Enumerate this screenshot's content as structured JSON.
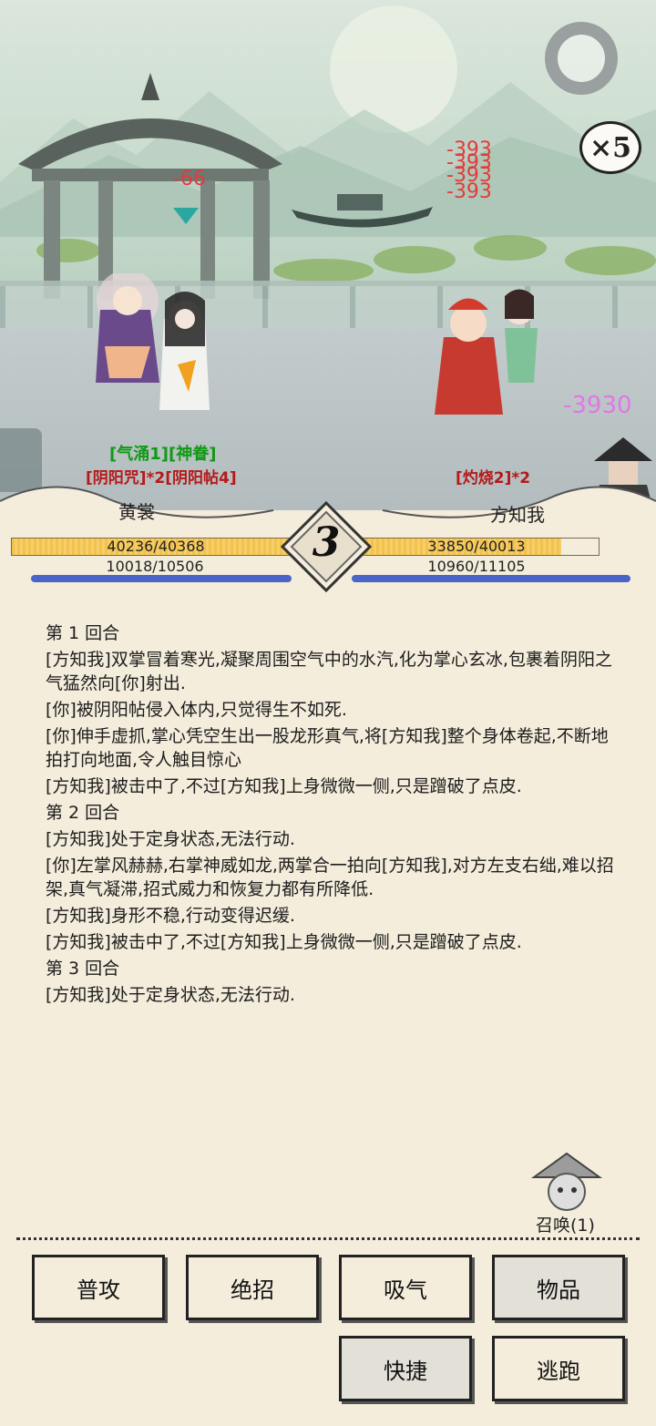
{
  "battle": {
    "speed": "×5",
    "damage_left": "-66",
    "damage_stack": [
      "-393",
      "-393",
      "-393",
      "-393"
    ],
    "damage_big": "-3930",
    "player_status_green": "[气涌1][神眷]",
    "player_status_red": "[阴阳咒]*2[阴阳帖4]",
    "enemy_status_red": "[灼烧2]*2"
  },
  "player": {
    "name": "黄裳",
    "hp": "40236/40368",
    "hp_fraction": 0.997,
    "mp": "10018/10506",
    "mp_fraction": 0.954
  },
  "enemy": {
    "name": "方知我",
    "hp": "33850/40013",
    "hp_fraction": 0.846,
    "mp": "10960/11105",
    "mp_fraction": 0.987
  },
  "round_number": "3",
  "log": [
    {
      "text": "第 1 回合",
      "round": true
    },
    {
      "text": "[方知我]双掌冒着寒光,凝聚周围空气中的水汽,化为掌心玄冰,包裹着阴阳之气猛然向[你]射出."
    },
    {
      "text": "[你]被阴阳帖侵入体内,只觉得生不如死."
    },
    {
      "text": "[你]伸手虚抓,掌心凭空生出一股龙形真气,将[方知我]整个身体卷起,不断地拍打向地面,令人触目惊心"
    },
    {
      "text": "[方知我]被击中了,不过[方知我]上身微微一侧,只是蹭破了点皮."
    },
    {
      "text": "第 2 回合",
      "round": true
    },
    {
      "text": "[方知我]处于定身状态,无法行动."
    },
    {
      "text": "[你]左掌风赫赫,右掌神威如龙,两掌合一拍向[方知我],对方左支右绌,难以招架,真气凝滞,招式威力和恢复力都有所降低."
    },
    {
      "text": "[方知我]身形不稳,行动变得迟缓."
    },
    {
      "text": "[方知我]被击中了,不过[方知我]上身微微一侧,只是蹭破了点皮."
    },
    {
      "text": "第 3 回合",
      "round": true
    },
    {
      "text": "[方知我]处于定身状态,无法行动."
    }
  ],
  "summon_label": "召唤(1)",
  "actions": {
    "attack": "普攻",
    "ultimate": "绝招",
    "breath": "吸气",
    "items": "物品",
    "quick": "快捷",
    "flee": "逃跑"
  },
  "colors": {
    "hp": "#f2c24b",
    "mp": "#4a64c8",
    "damage": "#e33b3b",
    "crit": "#e176e7"
  }
}
